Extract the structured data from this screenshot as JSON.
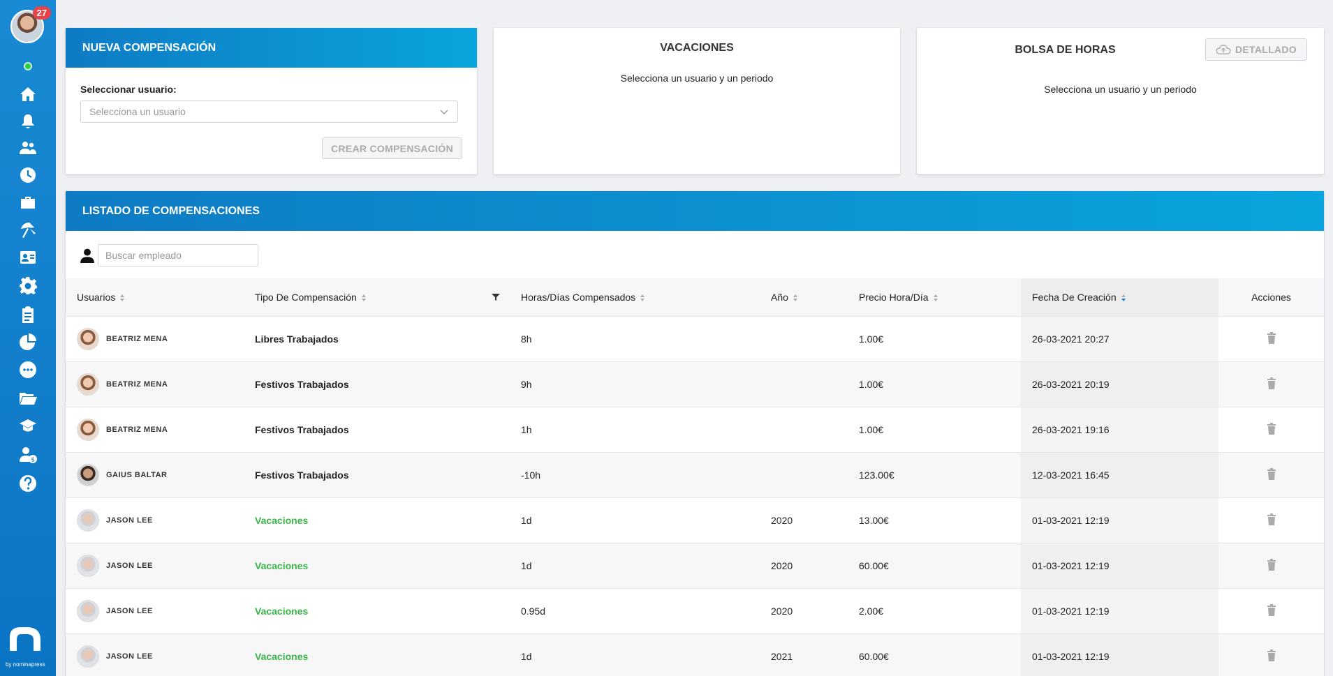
{
  "sidebar": {
    "badge_count": "27",
    "icons": [
      "home-icon",
      "bell-icon",
      "users-icon",
      "clock-icon",
      "briefcase-icon",
      "umbrella-icon",
      "id-card-icon",
      "gear-icon",
      "clipboard-icon",
      "pie-chart-icon",
      "chat-icon",
      "folder-icon",
      "graduation-icon",
      "user-money-icon",
      "help-icon"
    ],
    "brand_caption": "by nominapress"
  },
  "new_comp": {
    "title": "NUEVA COMPENSACIÓN",
    "user_label": "Seleccionar usuario:",
    "user_placeholder": "Selecciona un usuario",
    "create_button": "CREAR COMPENSACIÓN"
  },
  "vacaciones": {
    "title": "VACACIONES",
    "message": "Selecciona un usuario y un periodo"
  },
  "bolsa": {
    "title": "BOLSA DE HORAS",
    "detail_button": "DETALLADO",
    "message": "Selecciona un usuario y un periodo"
  },
  "listado": {
    "title": "LISTADO DE COMPENSACIONES",
    "search_placeholder": "Buscar empleado",
    "columns": [
      "Usuarios",
      "Tipo De Compensación",
      "Horas/Días Compensados",
      "Año",
      "Precio Hora/Día",
      "Fecha De Creación",
      "Acciones"
    ],
    "rows": [
      {
        "user": "BEATRIZ MENA",
        "type": "Libres Trabajados",
        "style": "bold",
        "amount": "8h",
        "year": "",
        "price": "1.00€",
        "date": "26-03-2021 20:27",
        "avatar": "female"
      },
      {
        "user": "BEATRIZ MENA",
        "type": "Festivos Trabajados",
        "style": "bold",
        "amount": "9h",
        "year": "",
        "price": "1.00€",
        "date": "26-03-2021 20:19",
        "avatar": "female"
      },
      {
        "user": "BEATRIZ MENA",
        "type": "Festivos Trabajados",
        "style": "bold",
        "amount": "1h",
        "year": "",
        "price": "1.00€",
        "date": "26-03-2021 19:16",
        "avatar": "female"
      },
      {
        "user": "GAIUS BALTAR",
        "type": "Festivos Trabajados",
        "style": "bold",
        "amount": "-10h",
        "year": "",
        "price": "123.00€",
        "date": "12-03-2021 16:45",
        "avatar": "male-dark"
      },
      {
        "user": "JASON LEE",
        "type": "Vacaciones",
        "style": "green",
        "amount": "1d",
        "year": "2020",
        "price": "13.00€",
        "date": "01-03-2021 12:19",
        "avatar": "male-grey"
      },
      {
        "user": "JASON LEE",
        "type": "Vacaciones",
        "style": "green",
        "amount": "1d",
        "year": "2020",
        "price": "60.00€",
        "date": "01-03-2021 12:19",
        "avatar": "male-grey"
      },
      {
        "user": "JASON LEE",
        "type": "Vacaciones",
        "style": "green",
        "amount": "0.95d",
        "year": "2020",
        "price": "2.00€",
        "date": "01-03-2021 12:19",
        "avatar": "male-grey"
      },
      {
        "user": "JASON LEE",
        "type": "Vacaciones",
        "style": "green",
        "amount": "1d",
        "year": "2021",
        "price": "60.00€",
        "date": "01-03-2021 12:19",
        "avatar": "male-grey"
      }
    ]
  },
  "colors": {
    "accent": "#0e7bc4",
    "accent_light": "#0aa5dc",
    "green": "#3ab54a",
    "badge": "#e8424a"
  }
}
